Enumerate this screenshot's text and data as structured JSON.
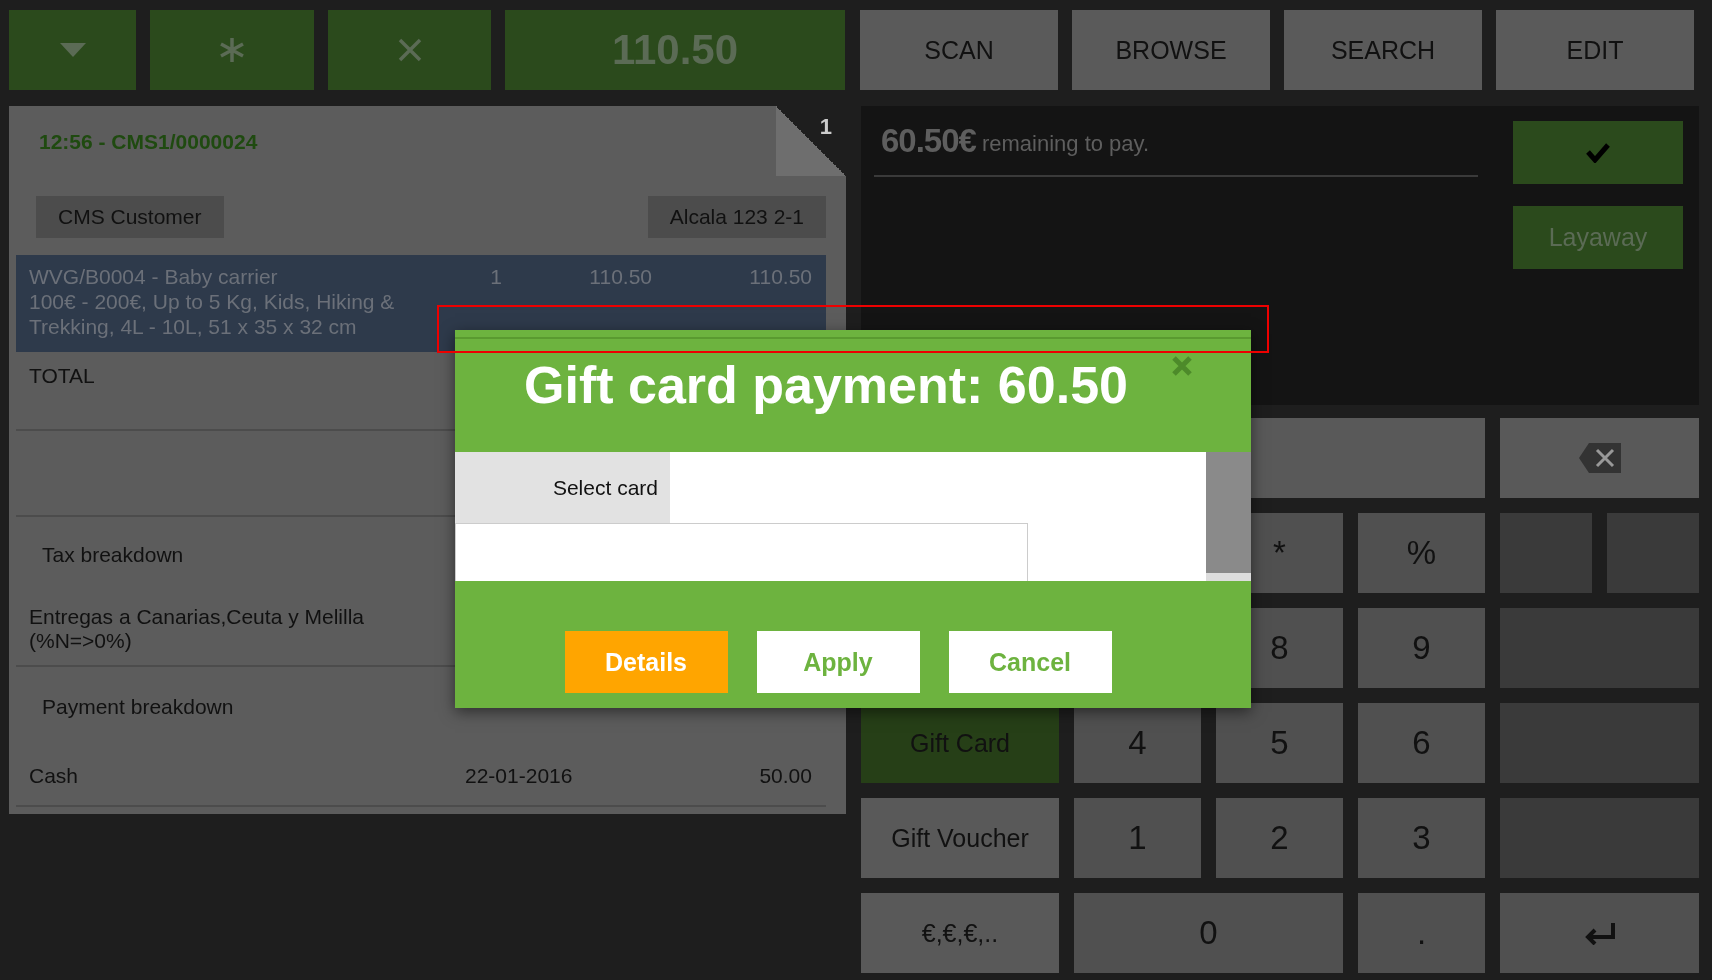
{
  "toolbar": {
    "total": "110.50",
    "actions": [
      {
        "label": "SCAN"
      },
      {
        "label": "BROWSE"
      },
      {
        "label": "SEARCH"
      },
      {
        "label": "EDIT"
      }
    ]
  },
  "receipt": {
    "header": "12:56 - CMS1/0000024",
    "ticket_number": "1",
    "customer": "CMS Customer",
    "address": "Alcala 123 2-1",
    "lines": [
      {
        "product": "WVG/B0004 - Baby carrier",
        "attributes": "100€ - 200€, Up to 5 Kg, Kids, Hiking & Trekking, 4L - 10L, 51 x 35 x 32 cm",
        "qty": "1",
        "price": "110.50",
        "amount": "110.50",
        "selected": true
      }
    ],
    "total_label": "TOTAL",
    "tax_title": "Tax breakdown",
    "taxes": [
      {
        "name": "Entregas a Canarias,Ceuta y Melilla (%N=>0%)"
      }
    ],
    "payment_title": "Payment breakdown",
    "payments": [
      {
        "method": "Cash",
        "date": "22-01-2016",
        "amount": "50.00"
      }
    ]
  },
  "payment_panel": {
    "remaining_amount": "60.50€",
    "remaining_text": "remaining to pay.",
    "layaway": "Layaway"
  },
  "keypad": [
    [
      {
        "kind": "display"
      },
      {
        "kind": "backspace"
      }
    ],
    [
      {
        "kind": "key",
        "label": "*"
      },
      {
        "kind": "key",
        "label": "%"
      },
      {
        "kind": "split"
      }
    ],
    [
      {
        "kind": "key",
        "label": "8"
      },
      {
        "kind": "key",
        "label": "9"
      },
      {
        "kind": "blank"
      }
    ],
    [
      {
        "kind": "method",
        "label": "Gift Card",
        "selected": true
      },
      {
        "kind": "key",
        "label": "4"
      },
      {
        "kind": "key",
        "label": "5"
      },
      {
        "kind": "key",
        "label": "6"
      },
      {
        "kind": "blank"
      }
    ],
    [
      {
        "kind": "method",
        "label": "Gift Voucher",
        "selected": false
      },
      {
        "kind": "key",
        "label": "1"
      },
      {
        "kind": "key",
        "label": "2"
      },
      {
        "kind": "key",
        "label": "3"
      },
      {
        "kind": "blank"
      }
    ],
    [
      {
        "kind": "method",
        "label": "€,€,€,..",
        "selected": false
      },
      {
        "kind": "zero",
        "label": "0"
      },
      {
        "kind": "key",
        "label": "."
      },
      {
        "kind": "enter"
      }
    ]
  ],
  "dialog": {
    "title": "Gift card payment: 60.50",
    "field_label": "Select card",
    "buttons": [
      {
        "label": "Details",
        "kind": "primary"
      },
      {
        "label": "Apply",
        "kind": "secondary"
      },
      {
        "label": "Cancel",
        "kind": "secondary"
      }
    ]
  }
}
